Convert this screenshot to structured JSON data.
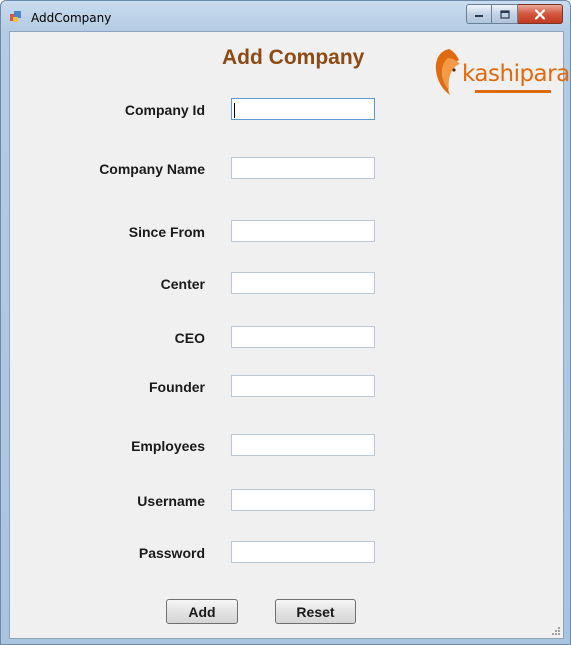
{
  "window": {
    "title": "AddCompany"
  },
  "form": {
    "heading": "Add Company",
    "logo_text": "kashipara",
    "fields": [
      {
        "label": "Company Id",
        "value": ""
      },
      {
        "label": "Company Name",
        "value": ""
      },
      {
        "label": "Since From",
        "value": ""
      },
      {
        "label": "Center",
        "value": ""
      },
      {
        "label": "CEO",
        "value": ""
      },
      {
        "label": "Founder",
        "value": ""
      },
      {
        "label": "Employees",
        "value": ""
      },
      {
        "label": "Username",
        "value": ""
      },
      {
        "label": "Password",
        "value": ""
      }
    ],
    "buttons": {
      "add": "Add",
      "reset": "Reset"
    }
  },
  "colors": {
    "heading": "#8c4a14",
    "logo": "#e06a10",
    "form_background": "#f0f0f0"
  },
  "icons": {
    "app": "app-window-icon",
    "minimize": "minimize-icon",
    "maximize": "maximize-icon",
    "close": "close-icon",
    "logo": "lion-logo-icon",
    "grip": "resize-grip-icon"
  }
}
